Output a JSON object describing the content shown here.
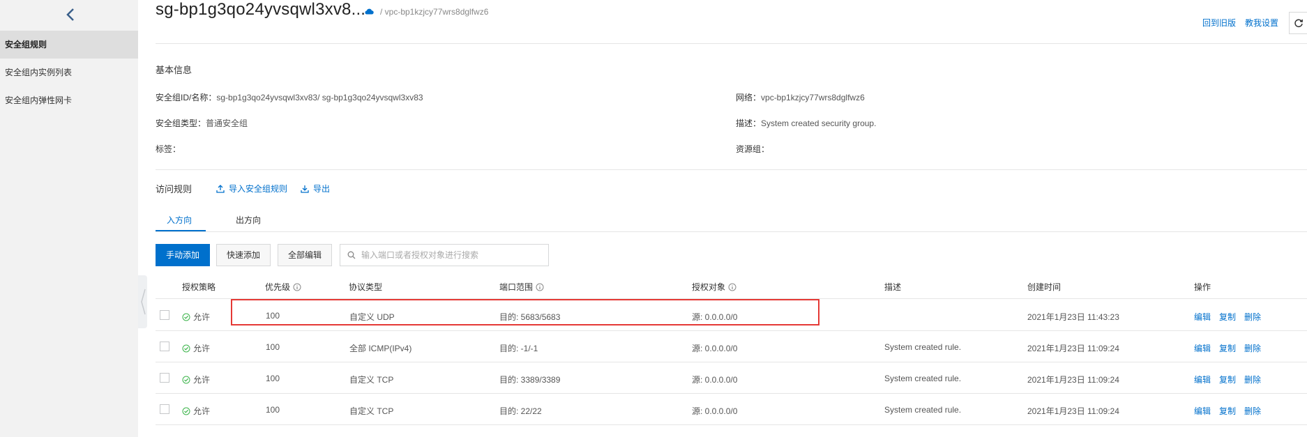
{
  "sidebar": {
    "items": [
      {
        "label": "安全组规则",
        "active": true
      },
      {
        "label": "安全组内实例列表",
        "active": false
      },
      {
        "label": "安全组内弹性网卡",
        "active": false
      }
    ]
  },
  "header": {
    "title": "sg-bp1g3qo24yvsqwl3xv8...",
    "vpc_breadcrumb": "/ vpc-bp1kzjcy77wrs8dglfwz6",
    "links": {
      "old_version": "回到旧版",
      "tutorial_settings": "教我设置"
    }
  },
  "basic_info": {
    "title": "基本信息",
    "fields": {
      "id_name": {
        "key": "安全组ID/名称：",
        "value": "sg-bp1g3qo24yvsqwl3xv83/ sg-bp1g3qo24yvsqwl3xv83"
      },
      "network": {
        "key": "网络：",
        "value": "vpc-bp1kzjcy77wrs8dglfwz6"
      },
      "type": {
        "key": "安全组类型：",
        "value": "普通安全组"
      },
      "description": {
        "key": "描述：",
        "value": "System created security group."
      },
      "tags": {
        "key": "标签：",
        "value": ""
      },
      "resource_group": {
        "key": "资源组：",
        "value": ""
      }
    }
  },
  "rules": {
    "title": "访问规则",
    "import_label": "导入安全组规则",
    "export_label": "导出",
    "tabs": {
      "inbound": "入方向",
      "outbound": "出方向"
    },
    "toolbar": {
      "manual_add": "手动添加",
      "quick_add": "快速添加",
      "edit_all": "全部编辑",
      "search_placeholder": "输入端口或者授权对象进行搜索"
    },
    "columns": {
      "policy": "授权策略",
      "priority": "优先级",
      "protocol": "协议类型",
      "port": "端口范围",
      "target": "授权对象",
      "desc": "描述",
      "created": "创建时间",
      "ops": "操作"
    },
    "rows": [
      {
        "policy": "允许",
        "priority": "100",
        "protocol": "自定义 UDP",
        "port": "目的: 5683/5683",
        "target": "源: 0.0.0.0/0",
        "desc": "",
        "created": "2021年1月23日 11:43:23",
        "edit": "编辑",
        "copy": "复制",
        "delete": "删除"
      },
      {
        "policy": "允许",
        "priority": "100",
        "protocol": "全部 ICMP(IPv4)",
        "port": "目的: -1/-1",
        "target": "源: 0.0.0.0/0",
        "desc": "System created rule.",
        "created": "2021年1月23日 11:09:24",
        "edit": "编辑",
        "copy": "复制",
        "delete": "删除"
      },
      {
        "policy": "允许",
        "priority": "100",
        "protocol": "自定义 TCP",
        "port": "目的: 3389/3389",
        "target": "源: 0.0.0.0/0",
        "desc": "System created rule.",
        "created": "2021年1月23日 11:09:24",
        "edit": "编辑",
        "copy": "复制",
        "delete": "删除"
      },
      {
        "policy": "允许",
        "priority": "100",
        "protocol": "自定义 TCP",
        "port": "目的: 22/22",
        "target": "源: 0.0.0.0/0",
        "desc": "System created rule.",
        "created": "2021年1月23日 11:09:24",
        "edit": "编辑",
        "copy": "复制",
        "delete": "删除"
      }
    ]
  },
  "colors": {
    "accent": "#0070cc",
    "allow_green": "#3cb44b",
    "highlight_red": "#e53935"
  }
}
